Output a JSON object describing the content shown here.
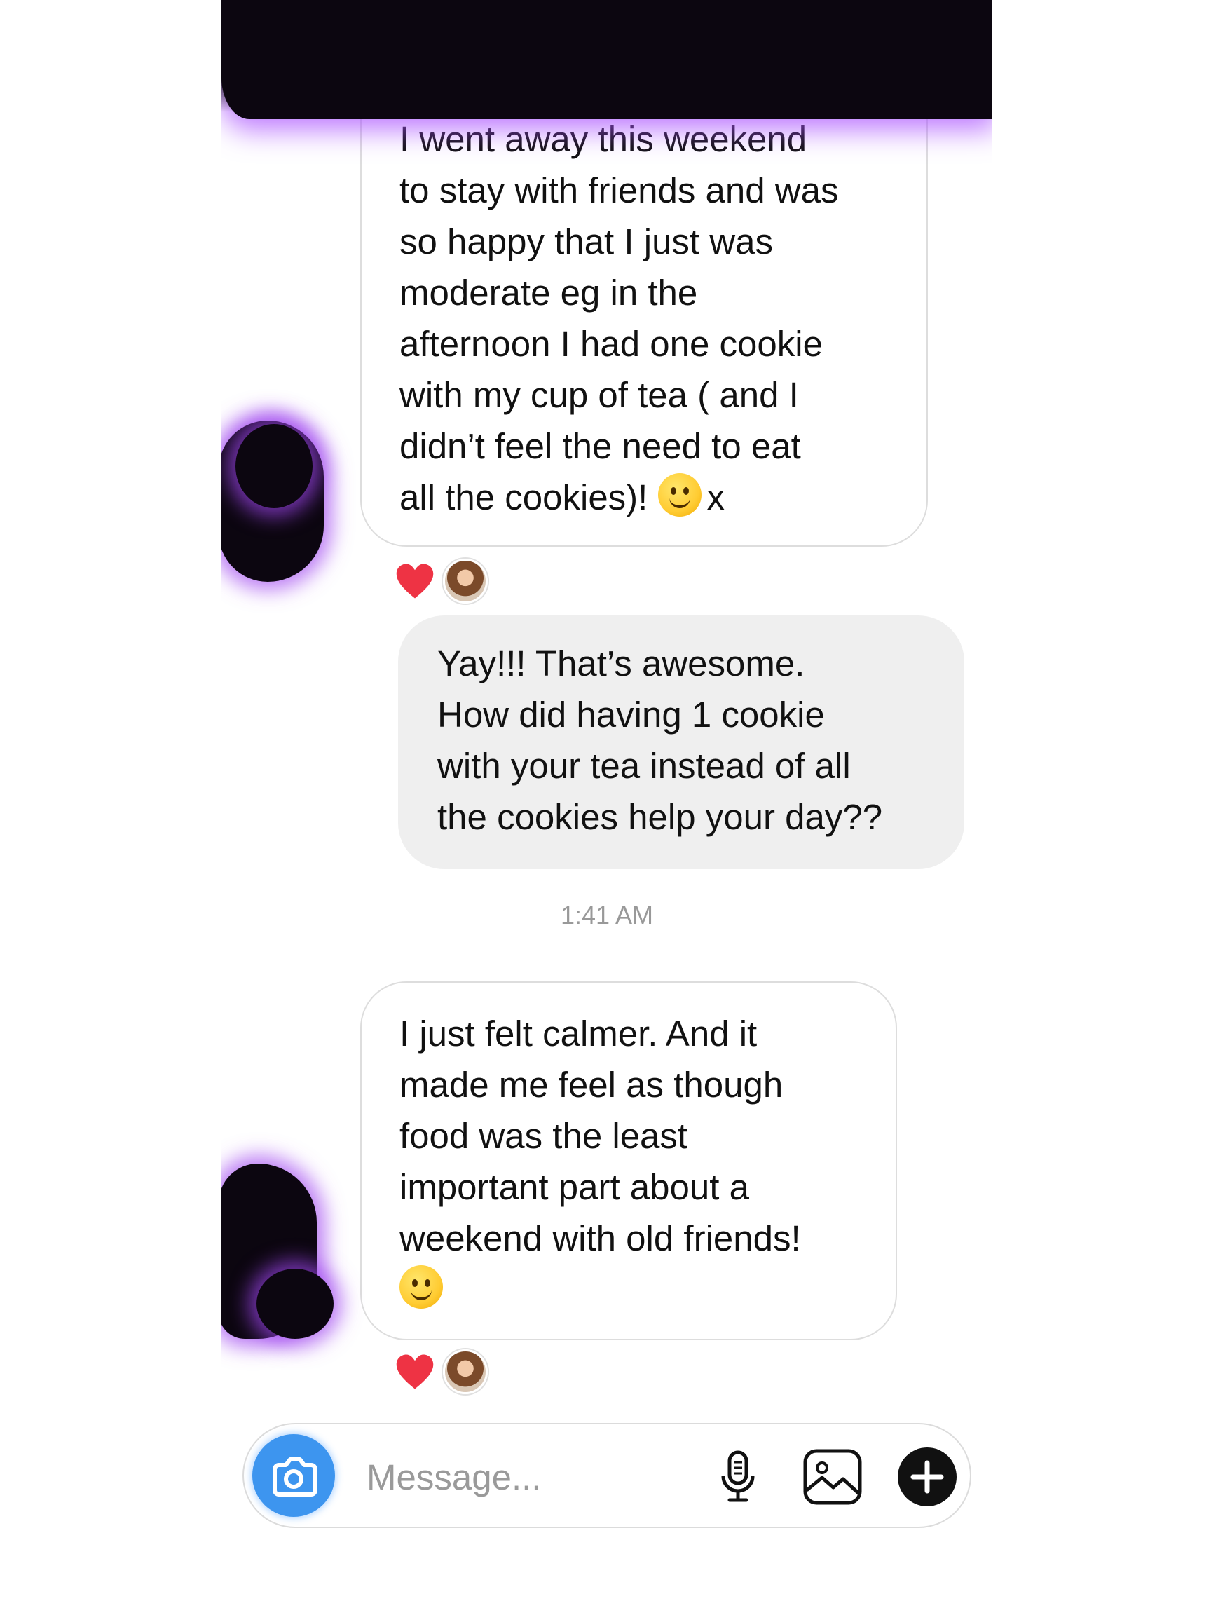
{
  "thread": {
    "messages": [
      {
        "direction": "incoming",
        "lines": [
          "I went away this weekend",
          "to stay with friends and was",
          "so happy that I just was",
          "moderate eg in the",
          "afternoon I had one cookie",
          "with my cup of tea ( and I",
          "didn’t feel the need to eat",
          "all the cookies)!"
        ],
        "trailing_text": "x",
        "reaction": "heart"
      },
      {
        "direction": "outgoing",
        "lines": [
          "Yay!!! That’s awesome.",
          "How did having 1 cookie",
          "with your tea instead of all",
          "the cookies help your day??"
        ]
      },
      {
        "direction": "incoming",
        "lines": [
          "I just felt calmer. And it",
          "made me feel as though",
          "food was the least",
          "important part about a",
          "weekend with old friends!"
        ],
        "reaction": "heart"
      }
    ],
    "timestamp": "1:41 AM"
  },
  "composer": {
    "placeholder": "Message...",
    "icons": [
      "camera-icon",
      "microphone-icon",
      "gallery-icon",
      "plus-icon"
    ]
  },
  "colors": {
    "camera_button": "#3d95ef",
    "heart": "#ee3344",
    "outgoing_bubble": "#efefef",
    "redaction_glow": "#a050f0"
  }
}
